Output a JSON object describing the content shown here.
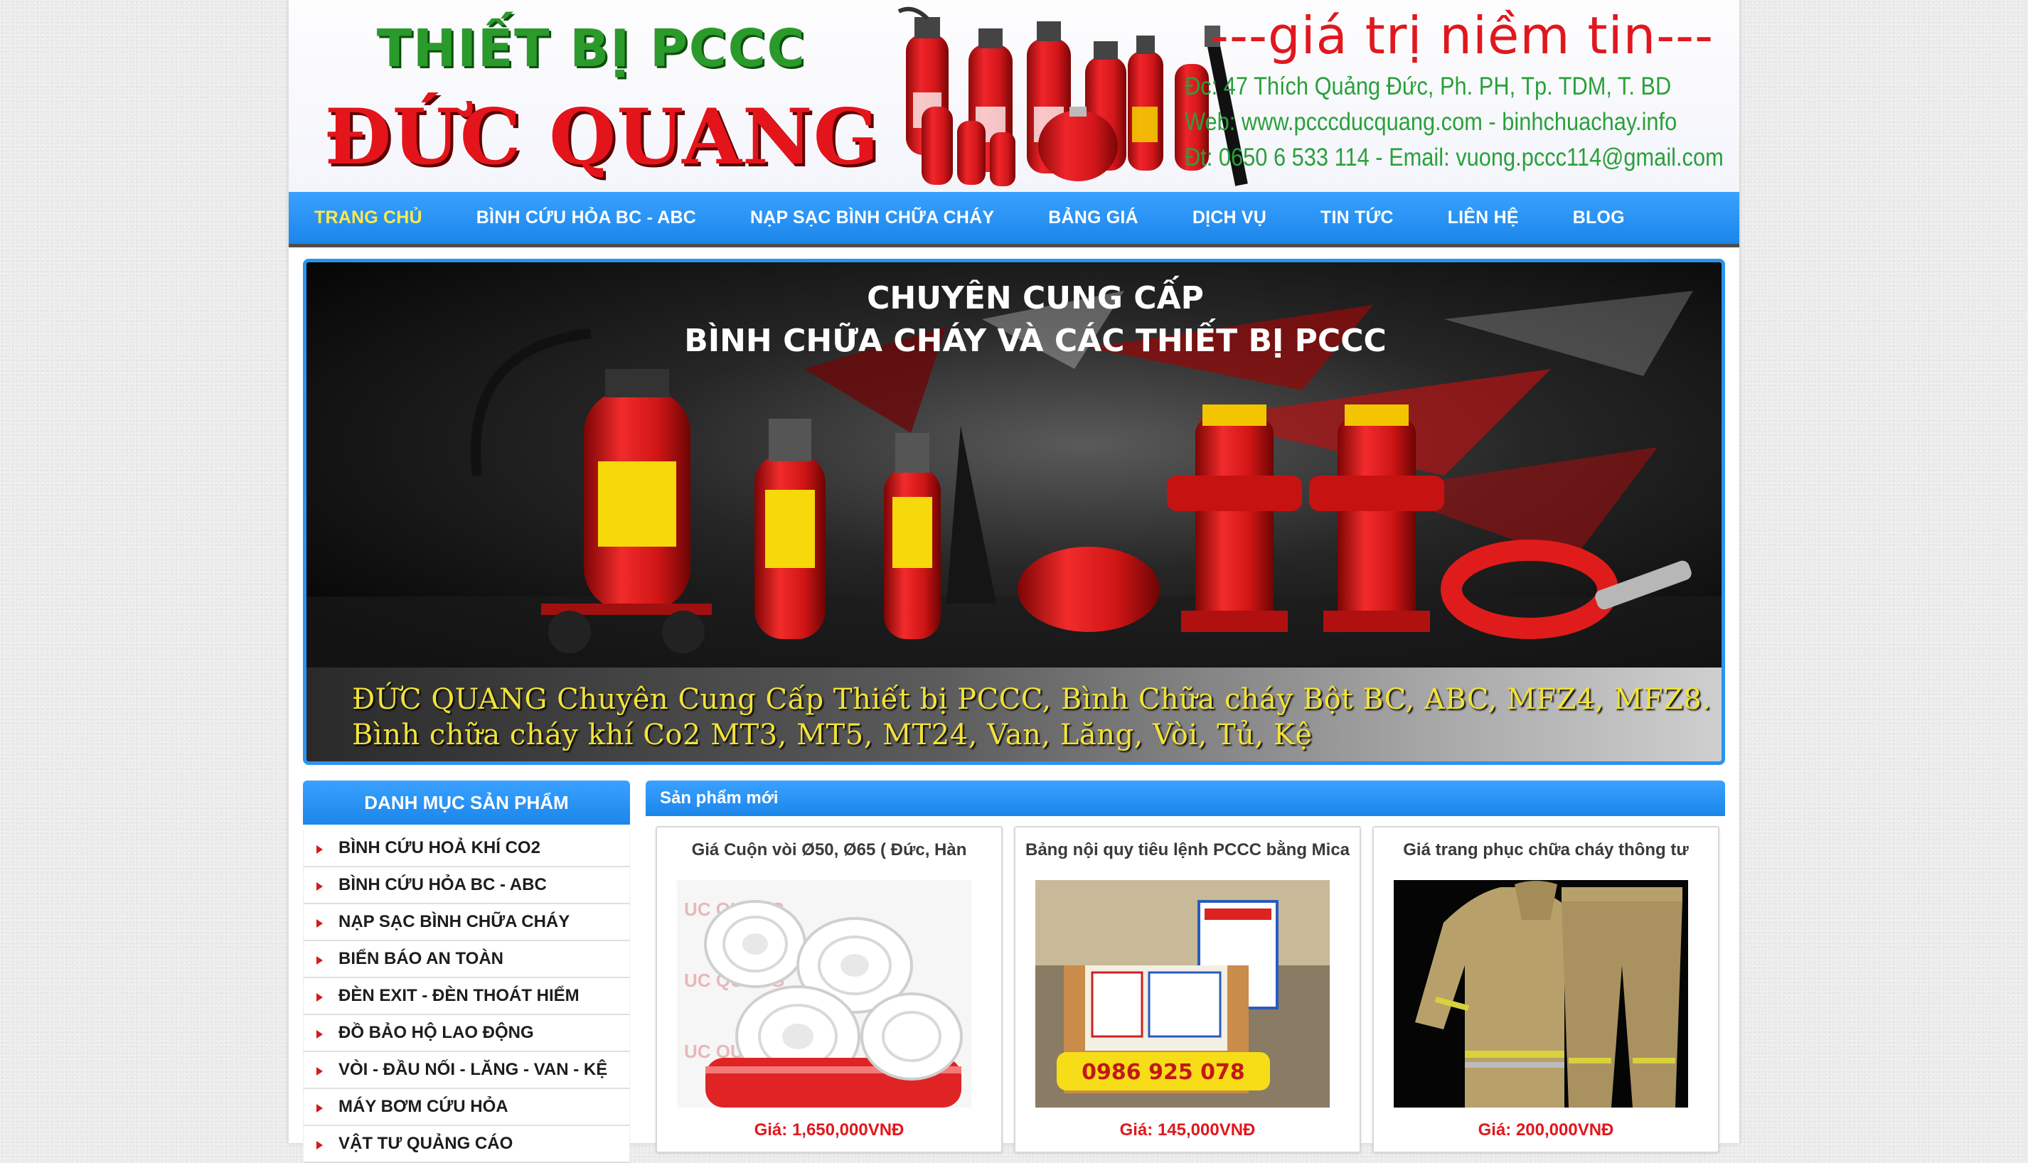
{
  "header": {
    "brand_top": "THIẾT BỊ PCCC",
    "brand_main": "ĐỨC QUANG",
    "slogan": "---giá trị niềm tin---",
    "address": "Đc: 47 Thích Quảng Đức, Ph. PH, Tp. TDM, T. BD",
    "web": "Web: www.pcccducquang.com - binhchuachay.info",
    "phone_email": "Đt: 0650 6 533 114 - Email: vuong.pccc114@gmail.com"
  },
  "nav": {
    "items": [
      {
        "label": "TRANG CHỦ",
        "active": true
      },
      {
        "label": "BÌNH CỨU HỎA BC - ABC"
      },
      {
        "label": "NẠP SẠC BÌNH CHỮA CHÁY"
      },
      {
        "label": "BẢNG GIÁ"
      },
      {
        "label": "DỊCH VỤ"
      },
      {
        "label": "TIN TỨC"
      },
      {
        "label": "LIÊN HỆ"
      },
      {
        "label": "BLOG"
      }
    ]
  },
  "hero": {
    "headline_1": "CHUYÊN CUNG CẤP",
    "headline_2": "BÌNH CHỮA CHÁY VÀ CÁC THIẾT BỊ PCCC",
    "caption_1": "ĐỨC QUANG Chuyên Cung Cấp Thiết bị PCCC, Bình Chữa cháy Bột BC, ABC, MFZ4, MFZ8.",
    "caption_2": "Bình chữa cháy khí Co2 MT3, MT5, MT24, Van, Lăng, Vòi, Tủ, Kệ"
  },
  "sidebar": {
    "title": "DANH MỤC SẢN PHẨM",
    "items": [
      {
        "label": "BÌNH CỨU HOẢ KHÍ CO2"
      },
      {
        "label": "BÌNH CỨU HỎA BC - ABC"
      },
      {
        "label": "NẠP SẠC BÌNH CHỮA CHÁY"
      },
      {
        "label": "BIỂN BÁO AN TOÀN"
      },
      {
        "label": "ĐÈN EXIT - ĐÈN THOÁT HIỂM"
      },
      {
        "label": "ĐỒ BẢO HỘ LAO ĐỘNG"
      },
      {
        "label": "VÒI - ĐẦU NỐI - LĂNG - VAN - KỆ"
      },
      {
        "label": "MÁY BƠM CỨU HỎA"
      },
      {
        "label": "VẬT TƯ QUẢNG CÁO"
      }
    ]
  },
  "products": {
    "title": "Sản phẩm mới",
    "items": [
      {
        "name": "Giá Cuộn vòi Ø50, Ø65 ( Đức, Hàn",
        "price": "Giá: 1,650,000VNĐ",
        "watermark": "UC QUANG"
      },
      {
        "name": "Bảng nội quy tiêu lệnh PCCC bằng Mica",
        "price": "Giá: 145,000VNĐ",
        "phone": "0986 925 078"
      },
      {
        "name": "Giá trang phục chữa cháy thông tư",
        "price": "Giá: 200,000VNĐ"
      }
    ]
  }
}
